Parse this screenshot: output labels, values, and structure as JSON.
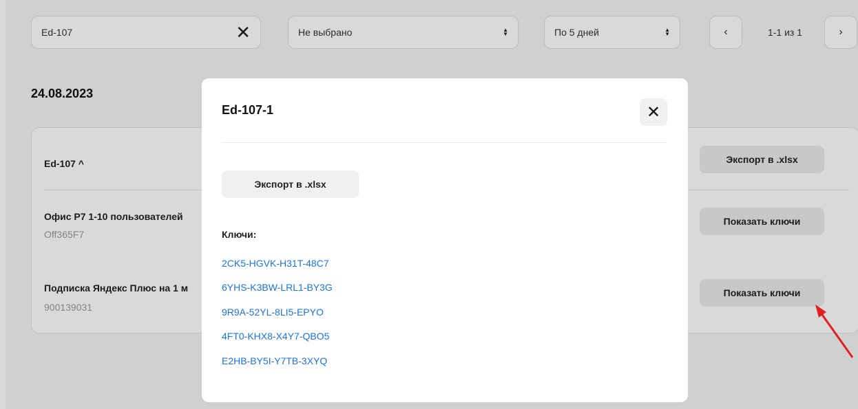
{
  "filters": {
    "search_value": "Ed-107",
    "clear_icon": "✕",
    "status_select": "Не выбрано",
    "period_select": "По 5 дней"
  },
  "pagination": {
    "prev_icon": "‹",
    "text": "1-1 из 1",
    "next_icon": "›"
  },
  "content": {
    "date": "24.08.2023",
    "group_title": "Ed-107 ^",
    "export_label": "Экспорт в .xlsx",
    "products": [
      {
        "name": "Офис Р7 1-10 пользователей",
        "code": "Off365F7",
        "button": "Показать ключи"
      },
      {
        "name": "Подписка Яндекс Плюс на 1 м",
        "code": "900139031",
        "button": "Показать ключи"
      }
    ]
  },
  "modal": {
    "title": "Ed-107-1",
    "close_icon": "✕",
    "export_label": "Экспорт в .xlsx",
    "keys_label": "Ключи:",
    "keys": [
      "2CK5-HGVK-H31T-48C7",
      "6YHS-K3BW-LRL1-BY3G",
      "9R9A-52YL-8LI5-EPYO",
      "4FT0-KHX8-X4Y7-QBO5",
      "E2HB-BY5I-Y7TB-3XYQ"
    ]
  },
  "colors": {
    "link": "#1a73e8",
    "arrow": "#e02020"
  }
}
